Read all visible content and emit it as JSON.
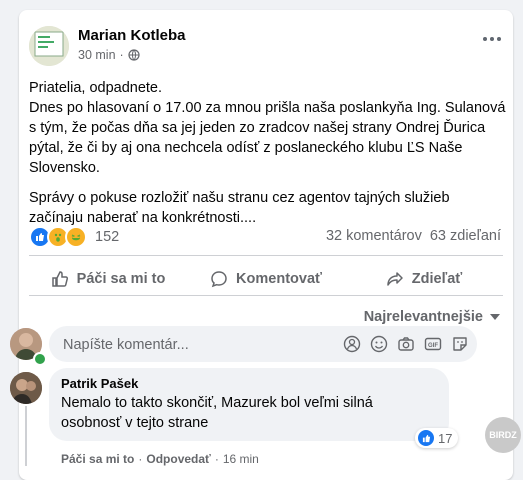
{
  "post": {
    "author": "Marian Kotleba",
    "time": "30 min",
    "visibility_icon": "globe-icon",
    "paragraphs": [
      "Priatelia, odpadnete.\nDnes po hlasovaní o 17.00 za mnou prišla naša poslankyňa Ing. Sulanová s tým, že počas dňa sa jej jeden zo zradcov našej strany Ondrej Ďurica pýtal, že či by aj ona nechcela odísť z poslaneckého klubu ĽS Naše Slovensko.",
      "Správy o pokuse rozložiť našu stranu cez agentov tajných služieb začínaju naberať na konkrétnosti...."
    ],
    "reaction_count": "152",
    "comments_count": "32 komentárov",
    "shares_count": "63 zdieľaní"
  },
  "actions": {
    "like": "Páči sa mi to",
    "comment": "Komentovať",
    "share": "Zdieľať"
  },
  "sort_label": "Najrelevantnejšie",
  "composer": {
    "placeholder": "Napíšte komentár..."
  },
  "comment": {
    "author": "Patrik Pašek",
    "text": "Nemalo to takto skončiť, Mazurek bol veľmi silná osobnosť v tejto strane",
    "reaction_count": "17",
    "like": "Páči sa mi to",
    "reply": "Odpovedať",
    "time": "16 min"
  },
  "watermark": "BIRDZ",
  "colors": {
    "accent": "#1877f2",
    "muted": "#65676b",
    "online": "#31a24c"
  }
}
